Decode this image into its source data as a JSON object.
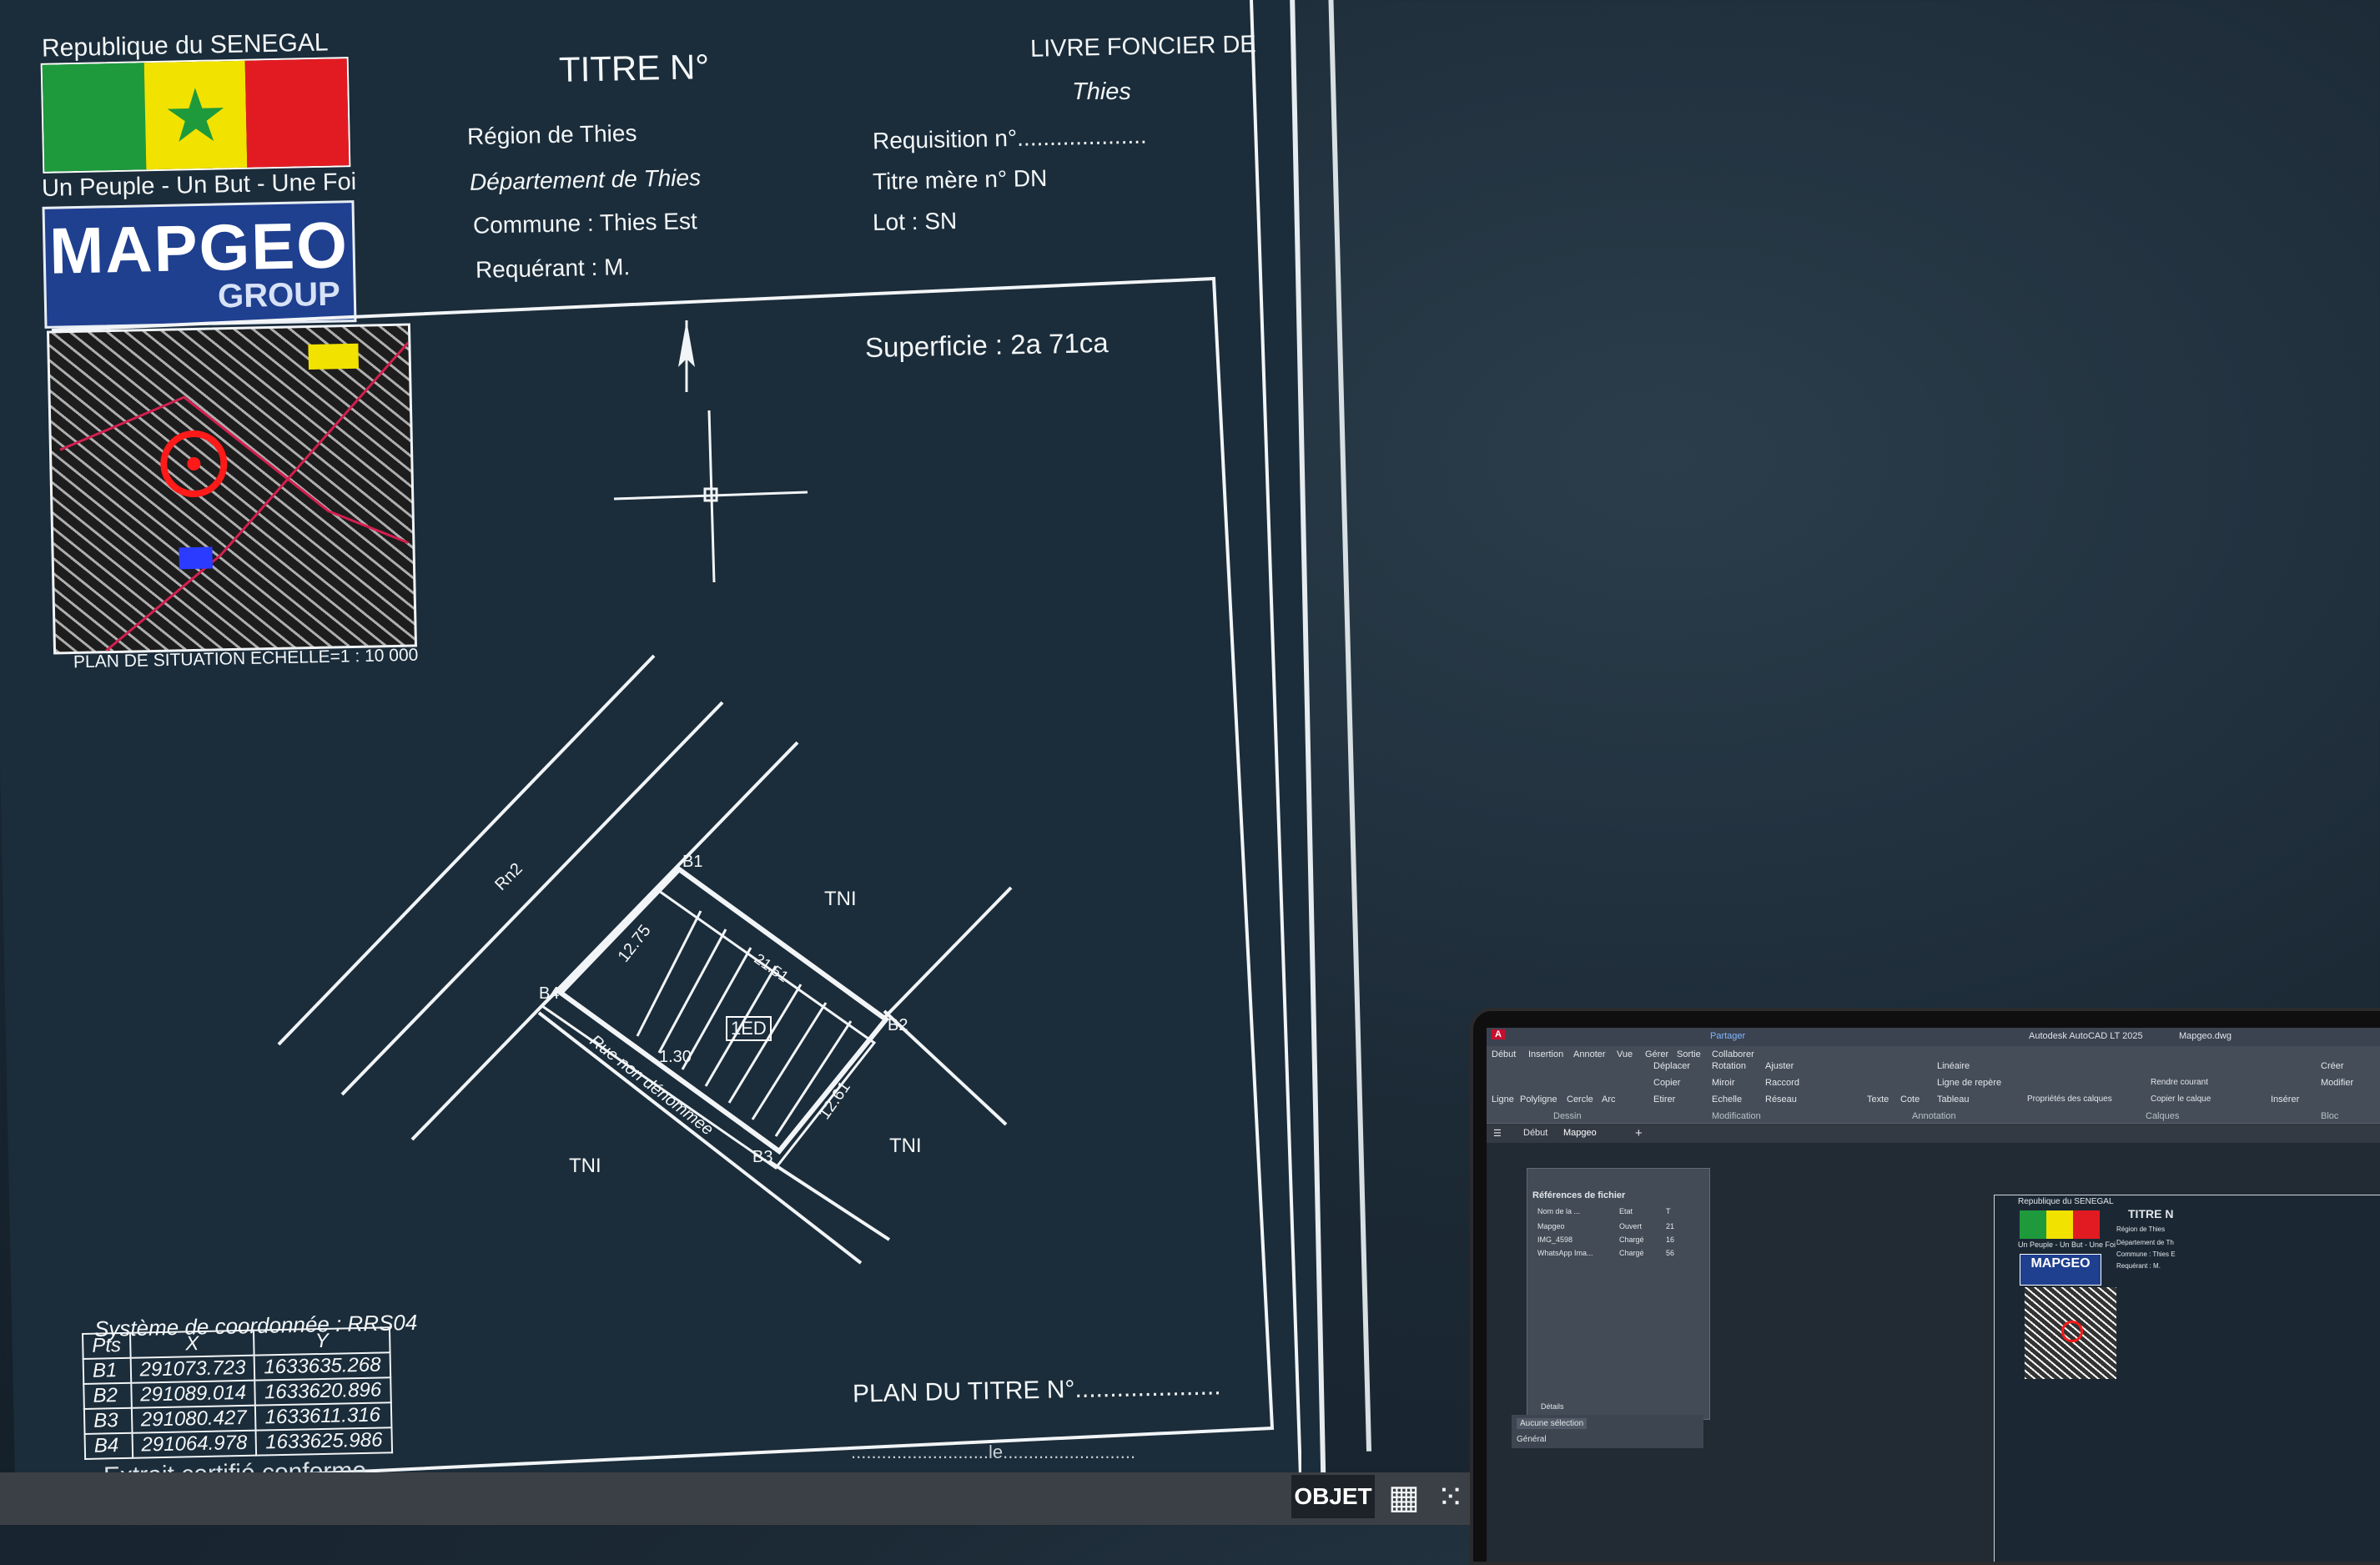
{
  "sheet": {
    "country": "Republique du SENEGAL",
    "motto": "Un Peuple - Un But - Une Foi",
    "logo_main": "MAPGEO",
    "logo_sub": "GROUP",
    "title": "TITRE N°",
    "livre_foncier": "LIVRE FONCIER DE",
    "livre_foncier_city": "Thies",
    "region": "Région de Thies",
    "departement": "Département  de Thies",
    "commune": "Commune : Thies Est",
    "requerant": "Requérant : M.",
    "requisition": "Requisition n°....................",
    "titre_mere": "Titre mère n° DN",
    "lot": "Lot : SN",
    "superficie": "Superficie : 2a 71ca",
    "north": "N",
    "plan_situation": "PLAN DE SITUATION ECHELLE=1 : 10 000",
    "coord_system": "Système de coordonnée : RRS04",
    "plan_titre": "PLAN DU TITRE N°.....................",
    "extrait": "Extrait certifié conforme",
    "date_line": "...........................le.........................."
  },
  "drawing": {
    "road_label": "Rn2",
    "street_label": "Rue non dénommée",
    "parcel_id": "1ED",
    "dim_1": "12.75",
    "dim_2": "12.61",
    "dim_3": "1.30",
    "dim_4": "21.51",
    "tni": "TNI",
    "points": [
      "B1",
      "B2",
      "B3",
      "B4"
    ]
  },
  "coord_table": {
    "headers": [
      "Pts",
      "X",
      "Y"
    ],
    "rows": [
      [
        "B1",
        "291073.723",
        "1633635.268"
      ],
      [
        "B2",
        "291089.014",
        "1633620.896"
      ],
      [
        "B3",
        "291080.427",
        "1633611.316"
      ],
      [
        "B4",
        "291064.978",
        "1633625.986"
      ]
    ]
  },
  "status": {
    "objet": "OBJET",
    "grid_icon": "grid-icon",
    "snap_icon": "snap-icon"
  },
  "laptop": {
    "app_title": "Autodesk AutoCAD LT 2025",
    "file": "Mapgeo.dwg",
    "share": "Partager",
    "ribbon_tabs": [
      "Début",
      "Insertion",
      "Annoter",
      "Vue",
      "Gérer",
      "Sortie",
      "Collaborer"
    ],
    "draw_tools": [
      "Ligne",
      "Polyligne",
      "Cercle",
      "Arc"
    ],
    "modify_tools": [
      "Déplacer",
      "Rotation",
      "Ajuster",
      "Copier",
      "Miroir",
      "Raccord",
      "Etirer",
      "Echelle",
      "Réseau"
    ],
    "annotation_tools": [
      "Texte",
      "Cote",
      "Linéaire",
      "Ligne de repère",
      "Tableau"
    ],
    "layer_tools": [
      "Propriétés des calques",
      "Rendre courant",
      "Copier le calque"
    ],
    "insert_tools": [
      "Insérer",
      "Créer",
      "Modifier"
    ],
    "panel_labels": [
      "Dessin",
      "Modification",
      "Annotation",
      "Calques",
      "Bloc"
    ],
    "doc_tabs": [
      "Début",
      "Mapgeo"
    ],
    "xref_title": "Références de fichier",
    "xref_columns": [
      "Nom de la ...",
      "Etat",
      "T"
    ],
    "xref_rows": [
      [
        "Mapgeo",
        "Ouvert",
        "21"
      ],
      [
        "IMG_4598",
        "Chargé",
        "16"
      ],
      [
        "WhatsApp Ima...",
        "Chargé",
        "56"
      ]
    ],
    "props_select": "Aucune sélection",
    "props_general": "Général",
    "props_detail": "Détails",
    "mini_country": "Republique du SENEGAL",
    "mini_motto": "Un Peuple - Un But - Une Foi",
    "mini_title": "TITRE N",
    "mini_region": "Région de Thies",
    "mini_departement": "Département de Th",
    "mini_commune": "Commune : Thies E",
    "mini_requerant": "Requérant : M."
  },
  "colors": {
    "sheet_bg": "#1b2c3a",
    "line": "#f2f5f7",
    "flag_green": "#1e9a3c",
    "flag_yellow": "#f2e200",
    "flag_red": "#e21b23",
    "logo_blue": "#1f3f8f"
  }
}
